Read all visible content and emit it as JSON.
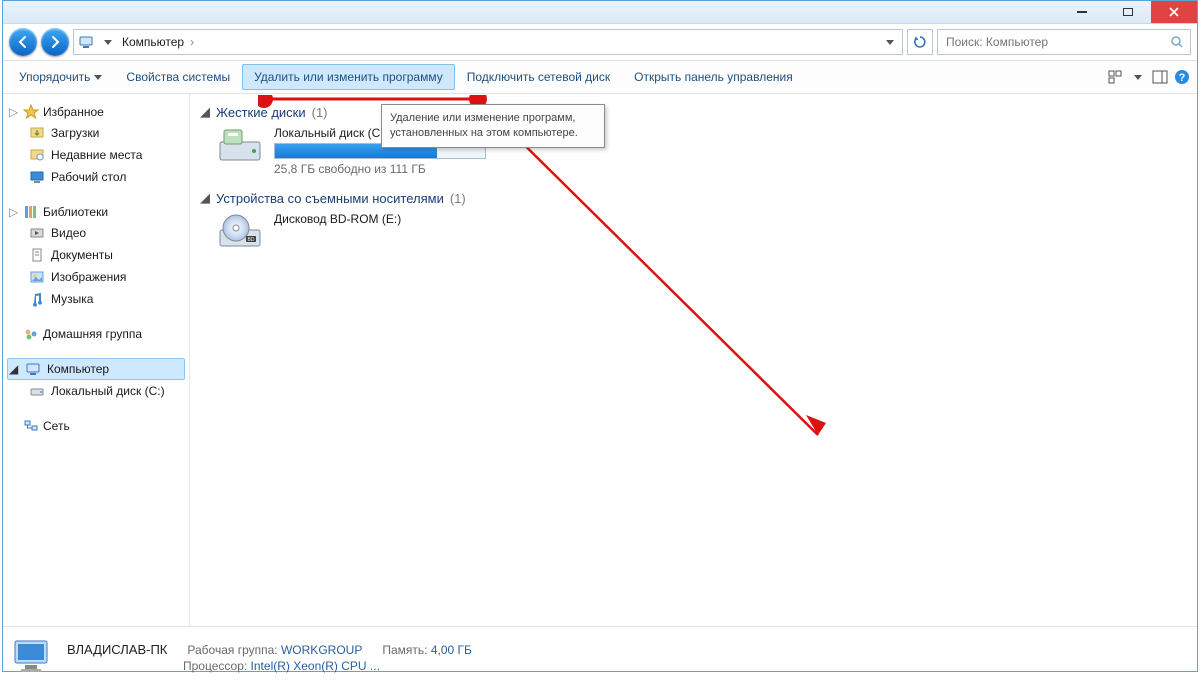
{
  "title_buttons": {
    "close": "×"
  },
  "address": {
    "location": "Компьютер",
    "crumb_sep": "›"
  },
  "search": {
    "placeholder": "Поиск: Компьютер"
  },
  "toolbar": {
    "organize": "Упорядочить",
    "system_props": "Свойства системы",
    "uninstall": "Удалить или изменить программу",
    "map_drive": "Подключить сетевой диск",
    "control_panel": "Открыть панель управления"
  },
  "tooltip": "Удаление или изменение программ, установленных на этом компьютере.",
  "sidebar": {
    "favorites": {
      "label": "Избранное",
      "items": [
        "Загрузки",
        "Недавние места",
        "Рабочий стол"
      ]
    },
    "libraries": {
      "label": "Библиотеки",
      "items": [
        "Видео",
        "Документы",
        "Изображения",
        "Музыка"
      ]
    },
    "homegroup": {
      "label": "Домашняя группа"
    },
    "computer": {
      "label": "Компьютер",
      "items": [
        "Локальный диск (C:)"
      ]
    },
    "network": {
      "label": "Сеть"
    }
  },
  "content": {
    "hdd": {
      "header": "Жесткие диски",
      "count": "(1)",
      "drive": {
        "name": "Локальный диск (C:)",
        "free": "25,8 ГБ свободно из 111 ГБ",
        "used_pct": 77
      }
    },
    "removable": {
      "header": "Устройства со съемными носителями",
      "count": "(1)",
      "drive": {
        "name": "Дисковод BD-ROM (E:)"
      }
    }
  },
  "statusbar": {
    "pc": "ВЛАДИСЛАВ-ПК",
    "workgroup_label": "Рабочая группа:",
    "workgroup": "WORKGROUP",
    "cpu_label": "Процессор:",
    "cpu": "Intel(R) Xeon(R) CPU    ...",
    "mem_label": "Память:",
    "mem": "4,00 ГБ"
  }
}
